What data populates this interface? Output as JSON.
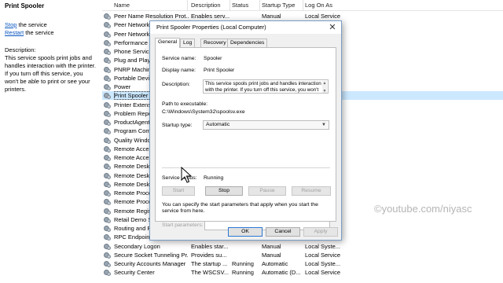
{
  "left": {
    "title": "Print Spooler",
    "stop_link": "Stop",
    "stop_rest": " the service",
    "restart_link": "Restart",
    "restart_rest": " the service",
    "desc_label": "Description:",
    "desc_text": "This service spools print jobs and handles interaction with the printer. If you turn off this service, you won't be able to print or see your printers."
  },
  "list": {
    "headers": [
      "Name",
      "Description",
      "Status",
      "Startup Type",
      "Log On As"
    ],
    "rows": [
      [
        "Peer Name Resolution Prot...",
        "Enables serv...",
        "",
        "Manual",
        "Local Service"
      ],
      [
        "Peer Networking Grouping",
        "",
        "",
        "",
        ""
      ],
      [
        "Peer Networking Identity",
        "",
        "",
        "",
        ""
      ],
      [
        "Performance Counter DLL",
        "",
        "",
        "",
        ""
      ],
      [
        "Phone Service",
        "",
        "",
        "",
        ""
      ],
      [
        "Plug and Play",
        "",
        "",
        "",
        ""
      ],
      [
        "PNRP Machine Name",
        "",
        "",
        "",
        ""
      ],
      [
        "Portable Device Enumerator",
        "",
        "",
        "",
        ""
      ],
      [
        "Power",
        "",
        "",
        "",
        ""
      ],
      [
        "Print Spooler",
        "",
        "",
        "",
        ""
      ],
      [
        "Printer Extensions and Notif",
        "",
        "",
        "",
        ""
      ],
      [
        "Problem Reports and Soluti",
        "",
        "",
        "",
        ""
      ],
      [
        "ProductAgentService",
        "",
        "",
        "",
        ""
      ],
      [
        "Program Compatibility Assi",
        "",
        "",
        "",
        ""
      ],
      [
        "Quality Windows Audio Vide",
        "",
        "",
        "",
        ""
      ],
      [
        "Remote Access Auto Conn",
        "",
        "",
        "",
        ""
      ],
      [
        "Remote Access Connection",
        "",
        "",
        "",
        ""
      ],
      [
        "Remote Desktop Configurat",
        "",
        "",
        "",
        ""
      ],
      [
        "Remote Desktop Services",
        "",
        "",
        "",
        ""
      ],
      [
        "Remote Desktop Services U",
        "",
        "",
        "",
        ""
      ],
      [
        "Remote Procedure Call (RPC)",
        "",
        "",
        "",
        ""
      ],
      [
        "Remote Procedure Call (RPC)",
        "",
        "",
        "",
        ""
      ],
      [
        "Remote Registry",
        "",
        "",
        "",
        ""
      ],
      [
        "Retail Demo Service",
        "",
        "",
        "",
        ""
      ],
      [
        "Routing and Remote Access",
        "",
        "",
        "",
        ""
      ],
      [
        "RPC Endpoint Mapper",
        "",
        "",
        "",
        ""
      ],
      [
        "Secondary Logon",
        "Enables star...",
        "",
        "Manual",
        "Local Syste..."
      ],
      [
        "Secure Socket Tunneling Pr...",
        "Provides su...",
        "",
        "Manual",
        "Local Service"
      ],
      [
        "Security Accounts Manager",
        "The startup ...",
        "Running",
        "Automatic",
        "Local Syste..."
      ],
      [
        "Security Center",
        "The WSCSV...",
        "Running",
        "Automatic (D...",
        "Local Service"
      ]
    ]
  },
  "dialog": {
    "title": "Print Spooler Properties (Local Computer)",
    "close_glyph": "✕",
    "tabs": [
      "General",
      "Log On",
      "Recovery",
      "Dependencies"
    ],
    "service_name_label": "Service name:",
    "service_name": "Spooler",
    "display_name_label": "Display name:",
    "display_name": "Print Spooler",
    "description_label": "Description:",
    "description": "This service spools print jobs and handles interaction with the printer.  If you turn off this service, you won't",
    "path_label": "Path to executable:",
    "path": "C:\\Windows\\System32\\spoolsv.exe",
    "startup_type_label": "Startup type:",
    "startup_type": "Automatic",
    "service_status_label": "Service status:",
    "service_status": "Running",
    "btn_start": "Start",
    "btn_stop": "Stop",
    "btn_pause": "Pause",
    "btn_resume": "Resume",
    "hint": "You can specify the start parameters that apply when you start the service from here.",
    "start_params_label": "Start parameters:",
    "start_params_value": "",
    "btn_ok": "OK",
    "btn_cancel": "Cancel",
    "btn_apply": "Apply"
  },
  "watermark": "©youtube.com/niyasc",
  "colors": {
    "link": "#0a56c2",
    "selected_row": "#cce8ff",
    "dialog_border": "#7a9ec7"
  }
}
